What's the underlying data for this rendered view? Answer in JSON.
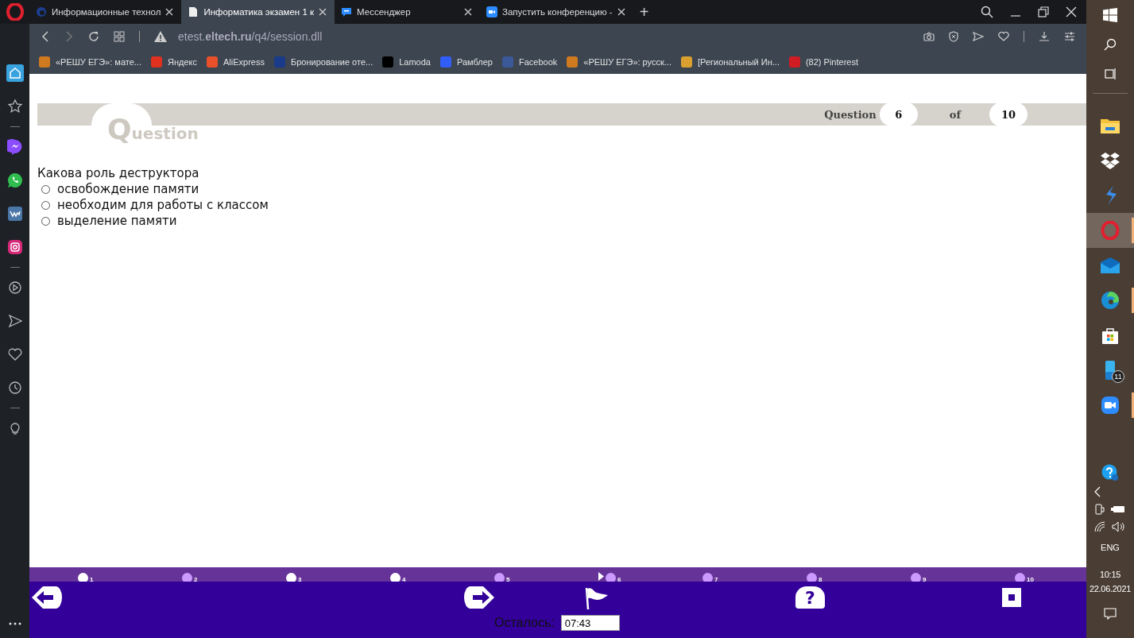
{
  "browser": {
    "tabs": [
      {
        "title": "Информационные технол",
        "kind": "edge",
        "selected": false
      },
      {
        "title": "Информатика экзамен 1 к",
        "kind": "doc",
        "selected": true
      },
      {
        "title": "Мессенджер",
        "kind": "chat",
        "selected": false
      },
      {
        "title": "Запустить конференцию -",
        "kind": "video",
        "selected": false
      }
    ],
    "new_tab": "+",
    "address": "etest.**eltech.ru**/q4/session.dll",
    "bookmarks": [
      {
        "title": "«РЕШУ ЕГЭ»: мате...",
        "color": "#d07a20"
      },
      {
        "title": "Яндекс",
        "color": "#e0301e"
      },
      {
        "title": "AliExpress",
        "color": "#e8502a"
      },
      {
        "title": "Бронирование оте...",
        "color": "#1a3b8a"
      },
      {
        "title": "Lamoda",
        "color": "#000000"
      },
      {
        "title": "Рамблер",
        "color": "#315efb"
      },
      {
        "title": "Facebook",
        "color": "#3b5998"
      },
      {
        "title": "«РЕШУ ЕГЭ»: русск...",
        "color": "#d07a20"
      },
      {
        "title": "[Региональный Ин...",
        "color": "#d9a030"
      },
      {
        "title": "(82) Pinterest",
        "color": "#d01c23"
      }
    ]
  },
  "sidebar": {
    "groups": [
      [
        {
          "kind": "home",
          "selected": true
        },
        {
          "kind": "star",
          "selected": false
        }
      ],
      [
        {
          "kind": "messenger",
          "selected": false
        },
        {
          "kind": "whatsapp",
          "selected": false
        },
        {
          "kind": "vk",
          "selected": false
        },
        {
          "kind": "instagram",
          "selected": false
        }
      ],
      [
        {
          "kind": "player",
          "selected": false
        },
        {
          "kind": "send",
          "selected": false
        },
        {
          "kind": "heart",
          "selected": false
        },
        {
          "kind": "clock",
          "selected": false
        }
      ],
      [
        {
          "kind": "bulb",
          "selected": false
        }
      ]
    ]
  },
  "quiz": {
    "logo": "Question",
    "header_label": "Question",
    "current": "6",
    "of_label": "of",
    "total": "10",
    "question": "Какова роль деструктора",
    "options": [
      {
        "text": "освобождение памяти",
        "selected": false
      },
      {
        "text": "необходим для работы с классом",
        "selected": false
      },
      {
        "text": "выделение памяти",
        "selected": false
      }
    ],
    "navigator": [
      {
        "number": "1",
        "visited": true,
        "selected": false
      },
      {
        "number": "2",
        "visited": false,
        "selected": false
      },
      {
        "number": "3",
        "visited": true,
        "selected": false
      },
      {
        "number": "4",
        "visited": true,
        "selected": false
      },
      {
        "number": "5",
        "visited": false,
        "selected": false
      },
      {
        "number": "6",
        "visited": false,
        "selected": true
      },
      {
        "number": "7",
        "visited": false,
        "selected": false
      },
      {
        "number": "8",
        "visited": false,
        "selected": false
      },
      {
        "number": "9",
        "visited": false,
        "selected": false
      },
      {
        "number": "10",
        "visited": false,
        "selected": false
      }
    ],
    "help_label": "?",
    "timer_label": "Осталось:",
    "timer_value": "07:43"
  },
  "taskbar": {
    "apps": [
      {
        "kind": "explorer",
        "active": false,
        "running": false
      },
      {
        "kind": "dropbox",
        "active": false,
        "running": false
      },
      {
        "kind": "bolt",
        "active": false,
        "running": false
      },
      {
        "kind": "opera",
        "active": true,
        "running": true
      },
      {
        "kind": "mail",
        "active": false,
        "running": false
      },
      {
        "kind": "edge",
        "active": false,
        "running": true
      },
      {
        "kind": "store",
        "active": false,
        "running": false
      },
      {
        "kind": "phone",
        "active": false,
        "running": false,
        "badge": "11"
      },
      {
        "kind": "zoom",
        "active": false,
        "running": true
      }
    ],
    "language": "ENG",
    "time": "10:15",
    "date": "22.06.2021"
  }
}
